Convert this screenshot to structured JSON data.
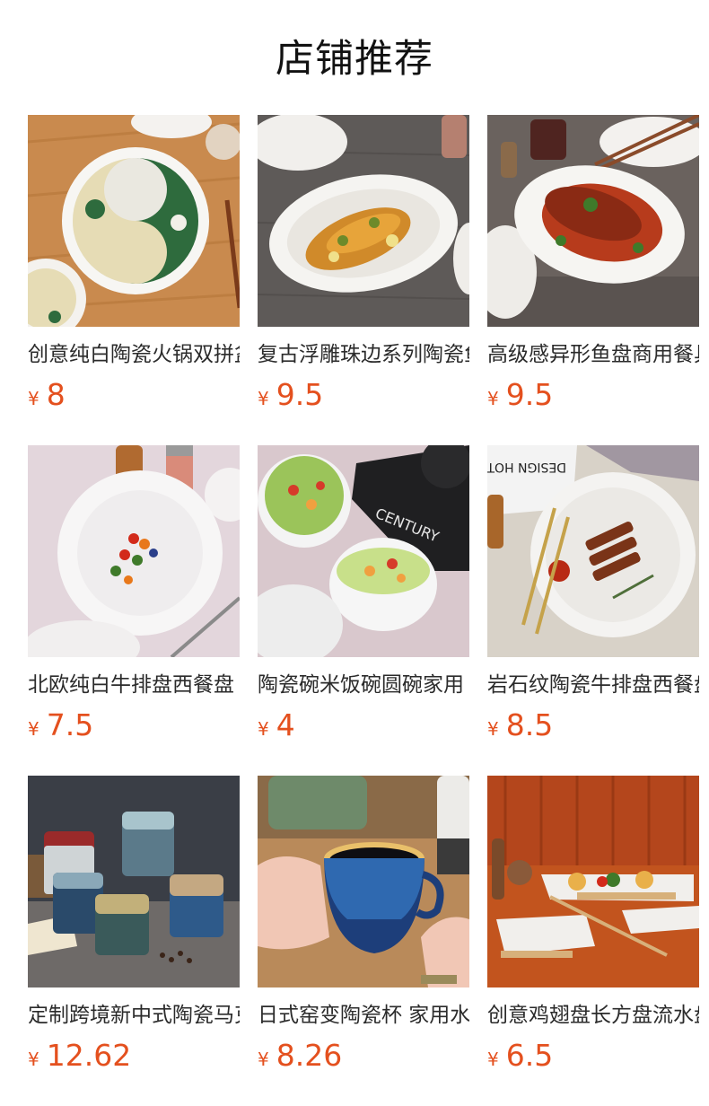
{
  "header": {
    "title": "店铺推荐"
  },
  "products": [
    {
      "name": "创意纯白陶瓷火锅双拼盆家用",
      "currency": "¥",
      "price": "8",
      "image": "yin-yang-congee-bowl"
    },
    {
      "name": "复古浮雕珠边系列陶瓷鱼盘",
      "currency": "¥",
      "price": "9.5",
      "image": "fish-on-embossed-oval-plate"
    },
    {
      "name": "高级感异形鱼盘商用餐具",
      "currency": "¥",
      "price": "9.5",
      "image": "braised-fish-leaf-plate"
    },
    {
      "name": "北欧纯白牛排盘西餐盘",
      "currency": "¥",
      "price": "7.5",
      "image": "white-scalloped-dessert-plate"
    },
    {
      "name": "陶瓷碗米饭碗圆碗家用",
      "currency": "¥",
      "price": "4",
      "image": "salad-bowls-with-book"
    },
    {
      "name": "岩石纹陶瓷牛排盘西餐盘",
      "currency": "¥",
      "price": "8.5",
      "image": "steak-on-rock-texture-plate"
    },
    {
      "name": "定制跨境新中式陶瓷马克杯",
      "currency": "¥",
      "price": "12.62",
      "image": "glazed-mugs-stack"
    },
    {
      "name": "日式窑变陶瓷杯 家用水杯",
      "currency": "¥",
      "price": "8.26",
      "image": "hands-holding-blue-cup"
    },
    {
      "name": "创意鸡翅盘长方盘流水盘",
      "currency": "¥",
      "price": "6.5",
      "image": "rectangular-sushi-plates"
    }
  ],
  "colors": {
    "price": "#e4501e",
    "title": "#111111",
    "name": "#2b2b2b"
  }
}
